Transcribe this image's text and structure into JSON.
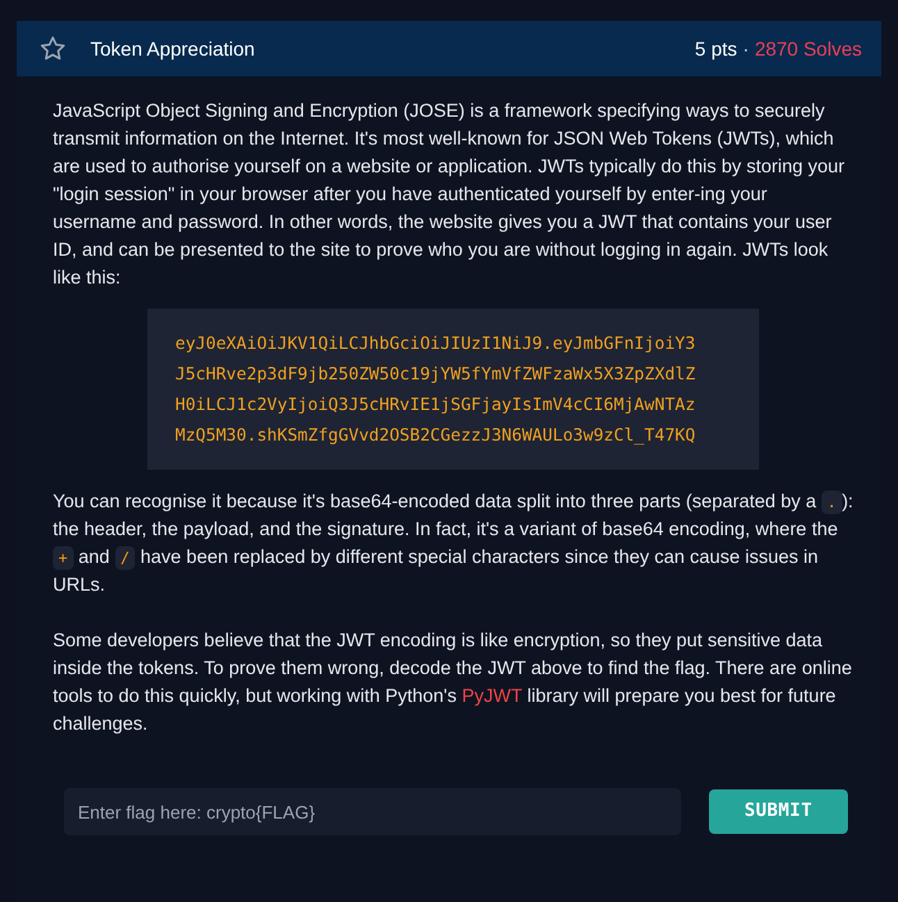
{
  "challenge": {
    "title": "Token Appreciation",
    "starred": false,
    "points": "5 pts",
    "separator": "·",
    "solves": "2870 Solves"
  },
  "paragraphs": [
    [
      {
        "kind": "text",
        "text": "JavaScript Object Signing and Encryption (JOSE) is a framework specifying ways to securely transmit information on the Internet. It's most well-known for JSON Web Tokens (JWTs), which are used to authorise yourself on a website or application. JWTs typically do this by storing your \"login session\" in your browser after you have authenticated yourself by enter-ing your username and password. In other words, the website gives you a JWT that contains your user ID, and can be presented to the site to prove who you are without logging in again. JWTs look like this:"
      }
    ]
  ],
  "code_block": [
    "eyJ0eXAiOiJKV1QiLCJhbGciOiJIUzI1NiJ9.eyJmbGFnIjoiY3",
    "J5cHRve2p3dF9jb250ZW50c19jYW5fYmVfZWFzaWx5X3ZpZXdlZ",
    "H0iLCJ1c2VyIjoiQ3J5cHRvIE1jSGFjayIsImV4cCI6MjAwNTAz",
    "MzQ5M30.shKSmZfgGVvd2OSB2CGezzJ3N6WAULo3w9zCl_T47KQ"
  ],
  "paragraphs_after": [
    [
      {
        "kind": "text",
        "text": "You can recognise it because it's base64-encoded data split into three parts (separated by a "
      },
      {
        "kind": "code",
        "text": "."
      },
      {
        "kind": "text",
        "text": "): the header, the payload, and the signature. In fact, it's a variant of base64 encoding, where the "
      },
      {
        "kind": "code",
        "text": "+"
      },
      {
        "kind": "text",
        "text": " and "
      },
      {
        "kind": "code",
        "text": "/"
      },
      {
        "kind": "text",
        "text": " have been replaced by different special characters since they can cause issues in URLs."
      }
    ],
    [
      {
        "kind": "text",
        "text": "Some developers believe that the JWT encoding is like encryption, so they put sensitive data inside the tokens. To prove them wrong, decode the JWT above to find the flag. There are online tools to do this quickly, but working with Python's "
      },
      {
        "kind": "link",
        "text": "PyJWT"
      },
      {
        "kind": "text",
        "text": " library will prepare you best for future challenges."
      }
    ]
  ],
  "flag_field": {
    "placeholder": "Enter flag here: crypto{FLAG}"
  },
  "submit_button": "SUBMIT"
}
